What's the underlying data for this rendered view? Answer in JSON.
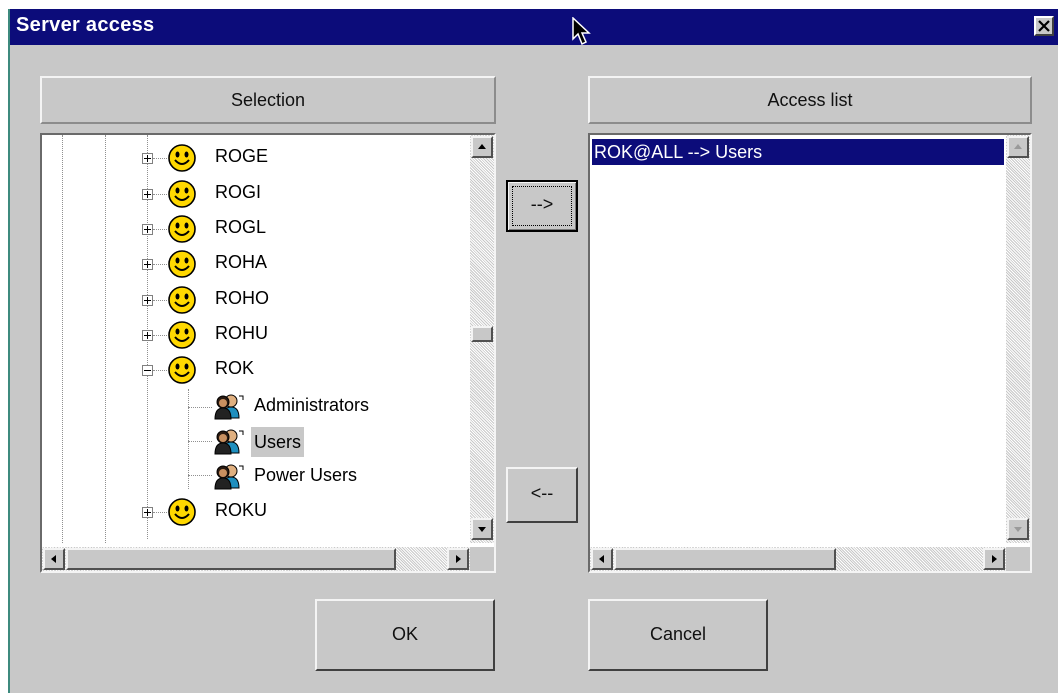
{
  "window": {
    "title": "Server access"
  },
  "selection": {
    "header": "Selection",
    "tree": [
      {
        "label": "ROGE",
        "expander": "plus",
        "icon": "smiley-icon"
      },
      {
        "label": "ROGI",
        "expander": "plus",
        "icon": "smiley-icon"
      },
      {
        "label": "ROGL",
        "expander": "plus",
        "icon": "smiley-icon"
      },
      {
        "label": "ROHA",
        "expander": "plus",
        "icon": "smiley-icon"
      },
      {
        "label": "ROHO",
        "expander": "plus",
        "icon": "smiley-icon"
      },
      {
        "label": "ROHU",
        "expander": "plus",
        "icon": "smiley-icon"
      },
      {
        "label": "ROK",
        "expander": "minus",
        "icon": "smiley-icon"
      },
      {
        "label": "Administrators",
        "icon": "group-icon"
      },
      {
        "label": "Users",
        "icon": "group-icon",
        "selected": true
      },
      {
        "label": "Power Users",
        "icon": "group-icon"
      },
      {
        "label": "ROKU",
        "expander": "plus",
        "icon": "smiley-icon"
      }
    ]
  },
  "transfer": {
    "add_label": "-->",
    "remove_label": "<--"
  },
  "access_list": {
    "header": "Access list",
    "items": [
      "ROK@ALL --> Users"
    ]
  },
  "buttons": {
    "ok": "OK",
    "cancel": "Cancel"
  },
  "colors": {
    "titlebar": "#0c0c7a",
    "dialog": "#c8c8c8",
    "selection": "#0c0c7a",
    "smiley": "#ffd800"
  }
}
